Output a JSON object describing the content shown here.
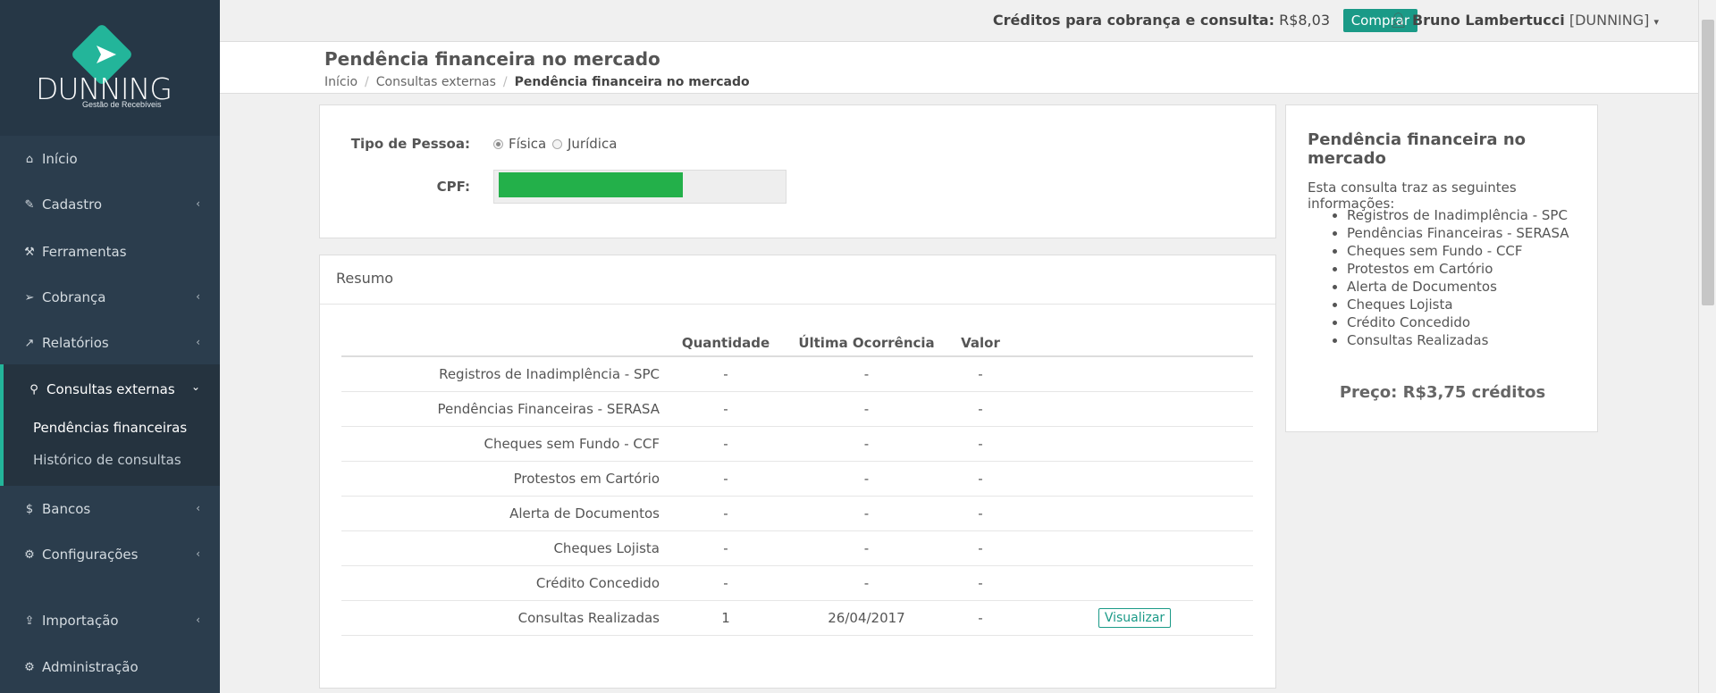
{
  "logo": {
    "text": "DUNNING",
    "tagline": "Gestão de Recebíveis"
  },
  "sidebar": {
    "items": [
      {
        "label": "Início",
        "icon": "home-icon"
      },
      {
        "label": "Cadastro",
        "icon": "edit-icon"
      },
      {
        "label": "Ferramentas",
        "icon": "wrench-icon"
      },
      {
        "label": "Cobrança",
        "icon": "send-icon"
      },
      {
        "label": "Relatórios",
        "icon": "chart-icon"
      },
      {
        "label": "Consultas externas",
        "icon": "search-icon"
      },
      {
        "label": "Bancos",
        "icon": "dollar-icon"
      },
      {
        "label": "Configurações",
        "icon": "gear-icon"
      },
      {
        "label": "Importação",
        "icon": "upload-icon"
      },
      {
        "label": "Administração",
        "icon": "gears-icon"
      }
    ],
    "subitems": [
      {
        "label": "Pendências financeiras"
      },
      {
        "label": "Histórico de consultas"
      }
    ]
  },
  "topbar": {
    "credits_label": "Créditos para cobrança e consulta:",
    "credits_value": "R$8,03",
    "buy_label": "Comprar",
    "user_name": "Bruno Lambertucci",
    "user_org": "[DUNNING]"
  },
  "header": {
    "title": "Pendência financeira no mercado",
    "breadcrumb": [
      "Início",
      "Consultas externas",
      "Pendência financeira no mercado"
    ]
  },
  "form": {
    "tipo_label": "Tipo de Pessoa:",
    "option_fisica": "Física",
    "option_juridica": "Jurídica",
    "cpf_label": "CPF:"
  },
  "resumo": {
    "title": "Resumo",
    "columns": [
      "Quantidade",
      "Última Ocorrência",
      "Valor"
    ],
    "rows": [
      {
        "label": "Registros de Inadimplência - SPC",
        "qtd": "-",
        "ultima": "-",
        "valor": "-"
      },
      {
        "label": "Pendências Financeiras - SERASA",
        "qtd": "-",
        "ultima": "-",
        "valor": "-"
      },
      {
        "label": "Cheques sem Fundo - CCF",
        "qtd": "-",
        "ultima": "-",
        "valor": "-"
      },
      {
        "label": "Protestos em Cartório",
        "qtd": "-",
        "ultima": "-",
        "valor": "-"
      },
      {
        "label": "Alerta de Documentos",
        "qtd": "-",
        "ultima": "-",
        "valor": "-"
      },
      {
        "label": "Cheques Lojista",
        "qtd": "-",
        "ultima": "-",
        "valor": "-"
      },
      {
        "label": "Crédito Concedido",
        "qtd": "-",
        "ultima": "-",
        "valor": "-"
      },
      {
        "label": "Consultas Realizadas",
        "qtd": "1",
        "ultima": "26/04/2017",
        "valor": "-",
        "action": "Visualizar"
      }
    ]
  },
  "info": {
    "title": "Pendência financeira no mercado",
    "intro": "Esta consulta traz as seguintes informações:",
    "items": [
      "Registros de Inadimplência - SPC",
      "Pendências Financeiras - SERASA",
      "Cheques sem Fundo - CCF",
      "Protestos em Cartório",
      "Alerta de Documentos",
      "Cheques Lojista",
      "Crédito Concedido",
      "Consultas Realizadas"
    ],
    "price": "Preço: R$3,75 créditos"
  },
  "colors": {
    "sidebar": "#2b3d4d",
    "accent": "#1a9a87",
    "cpf_fill": "#23b04a"
  }
}
